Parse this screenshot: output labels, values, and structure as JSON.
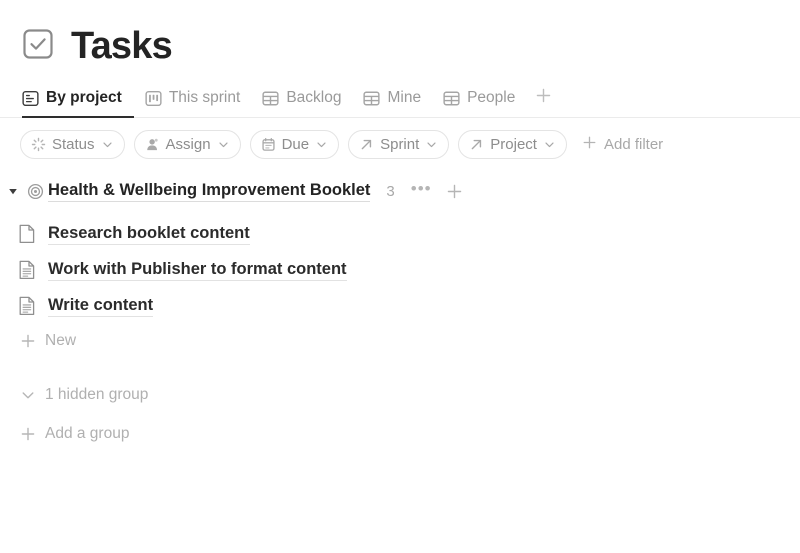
{
  "header": {
    "icon": "checkbox-checked-icon",
    "title": "Tasks"
  },
  "tabs": {
    "items": [
      {
        "label": "By project",
        "icon": "list-view-icon",
        "active": true
      },
      {
        "label": "This sprint",
        "icon": "board-view-icon",
        "active": false
      },
      {
        "label": "Backlog",
        "icon": "table-view-icon",
        "active": false
      },
      {
        "label": "Mine",
        "icon": "table-view-icon",
        "active": false
      },
      {
        "label": "People",
        "icon": "table-view-icon",
        "active": false
      }
    ],
    "add_label": "+",
    "add_icon": "plus-icon"
  },
  "filters": {
    "pills": [
      {
        "label": "Status",
        "icon": "spinner-icon"
      },
      {
        "label": "Assign",
        "icon": "person-icon"
      },
      {
        "label": "Due",
        "icon": "calendar-icon"
      },
      {
        "label": "Sprint",
        "icon": "arrow-up-right-icon"
      },
      {
        "label": "Project",
        "icon": "arrow-up-right-icon"
      }
    ],
    "add_filter_label": "Add filter",
    "add_filter_icon": "plus-icon"
  },
  "group": {
    "caret_icon": "triangle-down-icon",
    "icon": "target-icon",
    "title": "Health & Wellbeing Improvement Booklet",
    "count": "3",
    "more_label": "•••",
    "add_icon": "plus-icon"
  },
  "tasks": [
    {
      "title": "Research booklet content",
      "icon": "page-blank-icon"
    },
    {
      "title": "Work with Publisher to format content",
      "icon": "page-lines-icon"
    },
    {
      "title": "Write content",
      "icon": "page-lines-icon"
    }
  ],
  "footer": {
    "new_label": "New",
    "new_icon": "plus-icon",
    "hidden_group_label": "1 hidden group",
    "hidden_group_icon": "chevron-down-icon",
    "add_group_label": "Add a group",
    "add_group_icon": "plus-icon"
  },
  "colors": {
    "text_primary": "#242424",
    "text_muted": "#9a9a9a",
    "text_ghost": "#b0b0b0",
    "border": "#e4e4e4",
    "active_underline": "#2e2e2e",
    "background": "#ffffff"
  }
}
